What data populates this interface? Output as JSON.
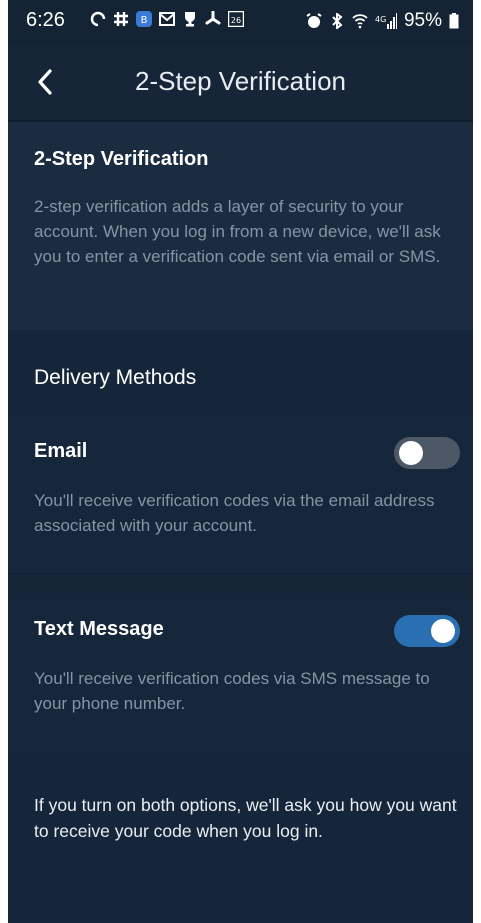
{
  "status_bar": {
    "time": "6:26",
    "battery": "95%",
    "left_icons": [
      "sync-icon",
      "slack-icon",
      "app-icon",
      "mail-icon",
      "trophy-icon",
      "fan-icon",
      "calendar-icon"
    ],
    "right_icons": [
      "alarm-icon",
      "bluetooth-icon",
      "wifi-icon",
      "signal-icon",
      "battery-icon"
    ],
    "calendar_day": "26",
    "network_label": "4G"
  },
  "header": {
    "title": "2-Step Verification"
  },
  "intro": {
    "heading": "2-Step Verification",
    "description": "2-step verification adds a layer of security to your account. When you log in from a new device, we'll ask you to enter a verification code sent via email or SMS."
  },
  "delivery": {
    "heading": "Delivery Methods"
  },
  "email": {
    "label": "Email",
    "enabled": false,
    "description": "You'll receive verification codes via the email address associated with your account."
  },
  "text_message": {
    "label": "Text Message",
    "enabled": true,
    "description": "You'll receive verification codes via SMS message to your phone number."
  },
  "footer_note": "If you turn on both options, we'll ask you how you want to receive your code when you log in.",
  "colors": {
    "background": "#162638",
    "card": "#1b2c40",
    "toggle_on": "#2a6fb2",
    "toggle_off": "#4d5866"
  }
}
